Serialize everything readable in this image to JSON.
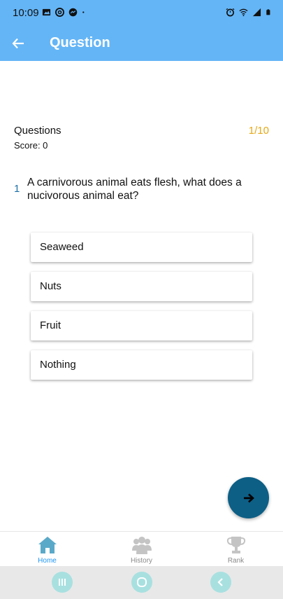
{
  "status_bar": {
    "time": "10:09",
    "left_icons": [
      "image-icon",
      "at-icon",
      "messenger-icon",
      "dot-icon"
    ],
    "right_icons": [
      "alarm-icon",
      "wifi-icon",
      "signal-icon",
      "battery-icon"
    ]
  },
  "app_bar": {
    "title": "Question",
    "back_icon": "arrow-left-icon",
    "background": "#64b5f6"
  },
  "quiz": {
    "questions_label": "Questions",
    "score_label": "Score: 0",
    "counter": "1/10",
    "counter_color": "#e6a817",
    "question_number": "1",
    "question_text": "A carnivorous animal eats flesh, what does a nucivorous animal eat?",
    "options": [
      "Seaweed",
      "Nuts",
      "Fruit",
      "Nothing"
    ]
  },
  "next_button": {
    "icon": "arrow-right-icon",
    "color": "#0d5f86"
  },
  "bottom_nav": {
    "items": [
      {
        "label": "Home",
        "icon": "home-icon",
        "active": true
      },
      {
        "label": "History",
        "icon": "people-icon",
        "active": false
      },
      {
        "label": "Rank",
        "icon": "trophy-icon",
        "active": false
      }
    ],
    "active_color": "#2196f3",
    "inactive_color": "#8a8a8a"
  },
  "system_nav": {
    "buttons": [
      "recents-icon",
      "home-circle-icon",
      "back-chevron-icon"
    ]
  }
}
